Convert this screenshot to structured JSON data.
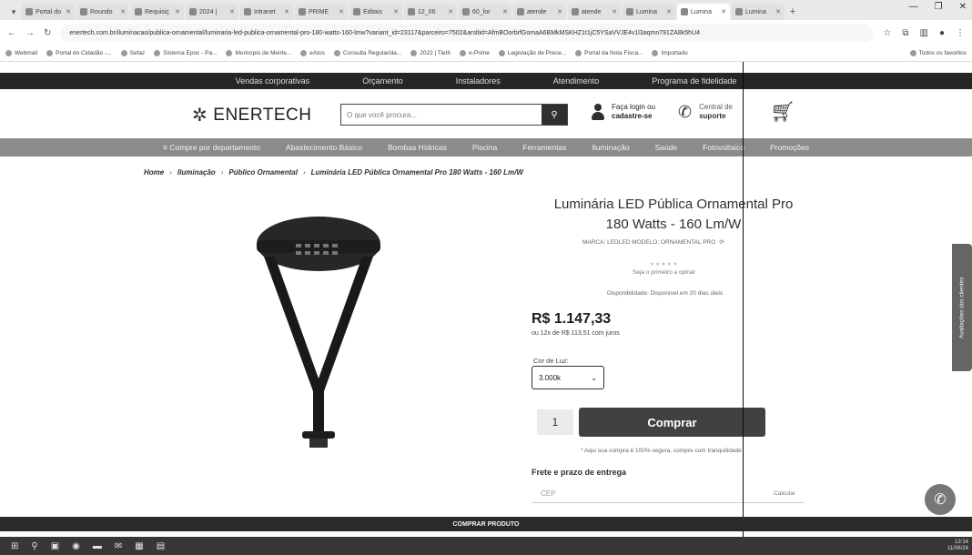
{
  "browser": {
    "tabs": [
      {
        "label": "Portal do"
      },
      {
        "label": "Roundo"
      },
      {
        "label": "Requisiç"
      },
      {
        "label": "2024 |"
      },
      {
        "label": "Intranet"
      },
      {
        "label": "PRIME"
      },
      {
        "label": "Editais"
      },
      {
        "label": "12_06"
      },
      {
        "label": "60_lor"
      },
      {
        "label": "atende"
      },
      {
        "label": "atende"
      },
      {
        "label": "Lumina"
      },
      {
        "label": "Lumina"
      },
      {
        "label": "Lumina"
      }
    ],
    "url": "enertech.com.br/iluminacao/publica-ornamental/luminaria-led-publica-ornamental-pro-180-watts-160-lmw?variant_id=23117&parceiro=7502&arsltid=AfmBOorbrfGomaA6BMkMSKHZ1t1jC5YSaVVJE4v1l3aqmn791ZA8k5hU4",
    "bookmarks": [
      "Webmail",
      "Portal do Cidadão -...",
      "Sefaz",
      "Sistema Epoc - Pa...",
      "Município de Meirle...",
      "eAtos",
      "Consulta Regularida...",
      "2022 | Tieth",
      "e-Prime",
      "Legislação de Prece...",
      "Portal da Nota Fisca...",
      "Importado"
    ],
    "bookmarks_right": "Todos os favoritos"
  },
  "site": {
    "topnav": [
      "Vendas corporativas",
      "Orçamento",
      "Instaladores",
      "Atendimento",
      "Programa de fidelidade"
    ],
    "logo": "ENERTECH",
    "search_placeholder": "O que você procura...",
    "account_line1": "Faça login ou",
    "account_line2": "cadastre-se",
    "central_line1": "Central de",
    "central_line2": "suporte",
    "categories": [
      "Compre por departamento",
      "Abastecimento Básico",
      "Bombas Hídricas",
      "Piscina",
      "Ferramentas",
      "Iluminação",
      "Saúde",
      "Fotovoltaico",
      "Promoções"
    ]
  },
  "breadcrumb": [
    "Home",
    "Iluminação",
    "Público Ornamental",
    "Luminária LED Pública Ornamental Pro 180 Watts - 160 Lm/W"
  ],
  "product": {
    "title_line1": "Luminária LED Pública Ornamental Pro",
    "title_line2": "180 Watts - 160 Lm/W",
    "meta": "MARCA: LEDLED   MODELO: ORNAMENTAL PRO",
    "rating_text": "Seja o primeiro a opinar",
    "availability": "Disponibilidade: Disponível em 20 dias úteis",
    "price": "R$ 1.147,33",
    "installments": "ou 12x de R$ 113,51 com juros",
    "color_label": "Cor de Luz:",
    "color_selected": "3.000k",
    "quantity": "1",
    "buy_label": "Comprar",
    "buy_note": "* Aqui sua compra é 100% segura, compre com tranquilidade",
    "shipping_title": "Frete e prazo de entrega",
    "cep_placeholder": "CEP",
    "calc_label": "Calcular"
  },
  "side_tab": "Avaliações dos clientes",
  "sticky_bar": "COMPRAR PRODUTO",
  "taskbar": {
    "time": "13:14",
    "date": "11/06/24"
  }
}
